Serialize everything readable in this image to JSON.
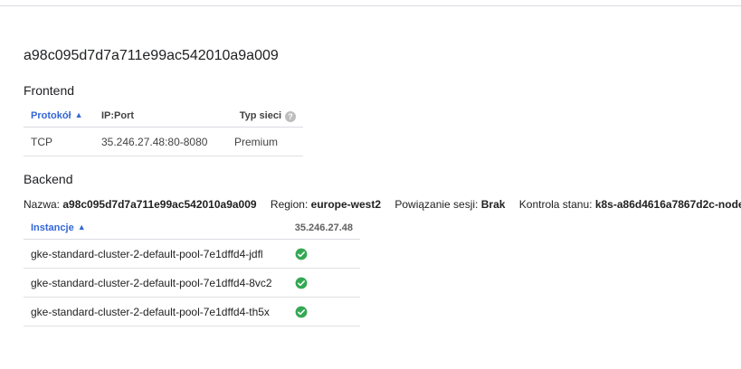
{
  "title": "a98c095d7d7a711e99ac542010a9a009",
  "frontend": {
    "heading": "Frontend",
    "columns": {
      "protocol": "Protokół",
      "ip_port": "IP:Port",
      "network_tier": "Typ sieci"
    },
    "rows": [
      {
        "protocol": "TCP",
        "ip_port": "35.246.27.48:80-8080",
        "network_tier": "Premium"
      }
    ]
  },
  "backend": {
    "heading": "Backend",
    "info": {
      "name_label": "Nazwa:",
      "name_value": "a98c095d7d7a711e99ac542010a9a009",
      "region_label": "Region:",
      "region_value": "europe-west2",
      "session_label": "Powiązanie sesji:",
      "session_value": "Brak",
      "health_label": "Kontrola stanu:",
      "health_value": "k8s-a86d4616a7867d2c-node"
    },
    "columns": {
      "instances": "Instancje",
      "ip": "35.246.27.48"
    },
    "rows": [
      {
        "instance": "gke-standard-cluster-2-default-pool-7e1dffd4-jdfl",
        "status_icon": "check-circle-icon"
      },
      {
        "instance": "gke-standard-cluster-2-default-pool-7e1dffd4-8vc2",
        "status_icon": "check-circle-icon"
      },
      {
        "instance": "gke-standard-cluster-2-default-pool-7e1dffd4-th5x",
        "status_icon": "check-circle-icon"
      }
    ]
  },
  "colors": {
    "accent": "#3367d6",
    "healthy": "#34a853"
  }
}
